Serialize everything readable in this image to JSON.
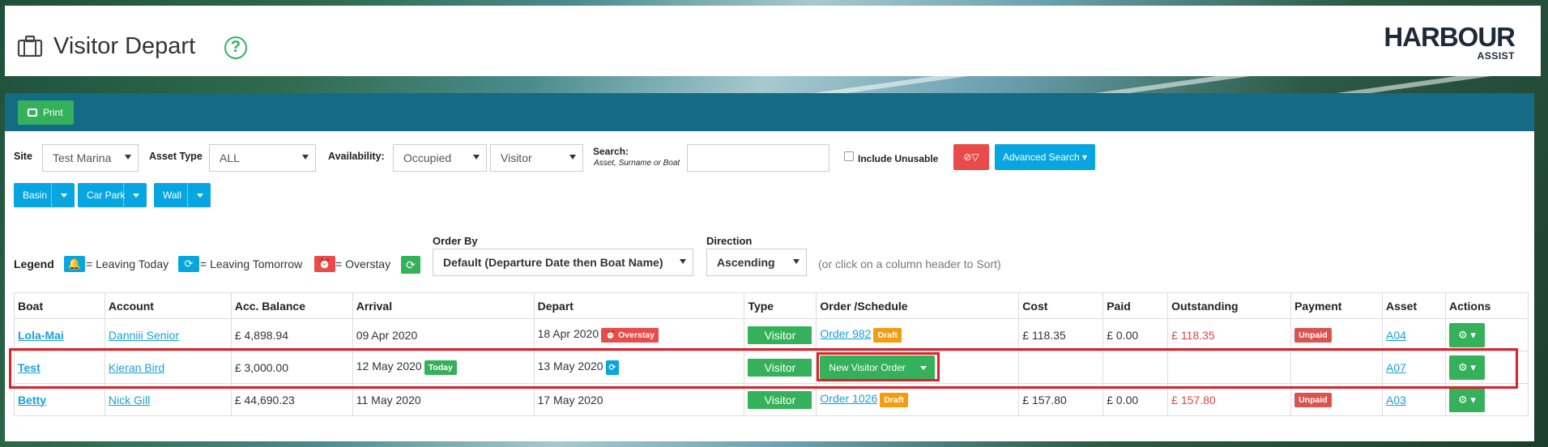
{
  "header": {
    "title": "Visitor Depart",
    "help_icon": "?",
    "logo_line1": "HARBOUR",
    "logo_line2": "ASSIST"
  },
  "toolbar": {
    "print_label": "Print"
  },
  "filters": {
    "site_label": "Site",
    "site_value": "Test Marina",
    "asset_type_label": "Asset Type",
    "asset_type_value": "ALL",
    "availability_label": "Availability:",
    "availability_value": "Occupied",
    "visitor_value": "Visitor",
    "search_label": "Search:",
    "search_hint": "Asset, Surname or Boat",
    "search_value": "",
    "include_unusable_label": "Include Unusable",
    "advanced_search_label": "Advanced Search"
  },
  "quick_buttons": [
    "Basin",
    "Car Park",
    "Wall"
  ],
  "legend": {
    "label": "Legend",
    "leaving_today": "= Leaving Today",
    "leaving_tomorrow": "= Leaving Tomorrow",
    "overstay": "= Overstay"
  },
  "order_by": {
    "label": "Order By",
    "value": "Default (Departure Date then Boat Name)"
  },
  "direction": {
    "label": "Direction",
    "value": "Ascending",
    "hint": "(or click on a column header to Sort)"
  },
  "table": {
    "headers": [
      "Boat",
      "Account",
      "Acc. Balance",
      "Arrival",
      "Depart",
      "Type",
      "Order /Schedule",
      "Cost",
      "Paid",
      "Outstanding",
      "Payment",
      "Asset",
      "Actions"
    ],
    "rows": [
      {
        "boat": "Lola-Mai",
        "account": "Danniii Senior",
        "balance": "£ 4,898.94",
        "arrival": "09 Apr 2020",
        "depart": "18 Apr 2020",
        "depart_badge": "Overstay",
        "type": "Visitor",
        "order": "Order 982",
        "order_badge": "Draft",
        "cost": "£ 118.35",
        "paid": "£ 0.00",
        "outstanding": "£ 118.35",
        "payment": "Unpaid",
        "asset": "A04"
      },
      {
        "boat": "Test",
        "account": "Kieran Bird",
        "balance": "£ 3,000.00",
        "arrival": "12 May 2020",
        "arrival_badge": "Today",
        "depart": "13 May 2020",
        "type": "Visitor",
        "order_button": "New Visitor Order",
        "asset": "A07"
      },
      {
        "boat": "Betty",
        "account": "Nick Gill",
        "balance": "£ 44,690.23",
        "arrival": "11 May 2020",
        "depart": "17 May 2020",
        "type": "Visitor",
        "order": "Order 1026",
        "order_badge": "Draft",
        "cost": "£ 157.80",
        "paid": "£ 0.00",
        "outstanding": "£ 157.80",
        "payment": "Unpaid",
        "asset": "A03"
      }
    ]
  },
  "colors": {
    "primary_green": "#34b15a",
    "accent_blue": "#07a6e1",
    "bar_teal": "#136b85",
    "danger": "#e94b48",
    "highlight": "#d9222a"
  }
}
